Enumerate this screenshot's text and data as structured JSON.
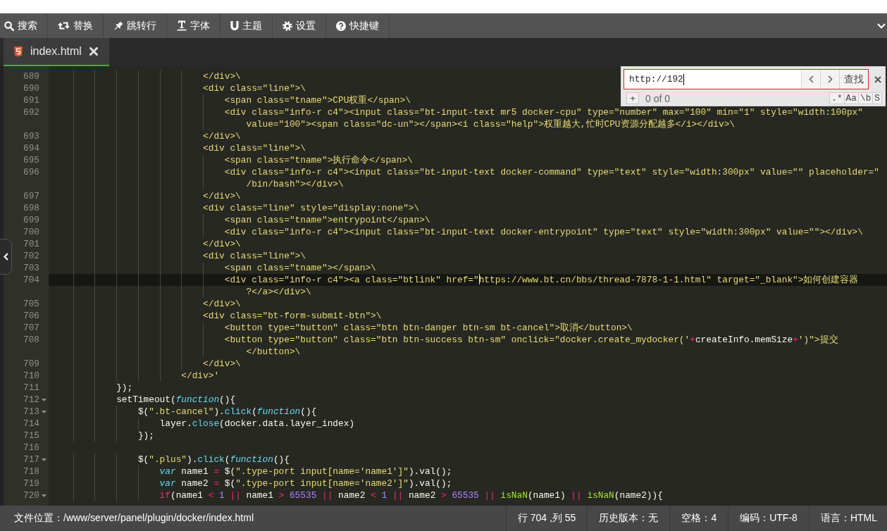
{
  "toolbar": {
    "items": [
      "搜索",
      "替换",
      "跳转行",
      "字体",
      "主题",
      "设置",
      "快捷键"
    ]
  },
  "tabs": [
    {
      "label": "index.html",
      "selected": true
    }
  ],
  "editor": {
    "lines": [
      {
        "number": "689",
        "foldable": false,
        "current": false,
        "tokens": [
          {
            "kind": "string",
            "text": "                            </div>\\"
          }
        ]
      },
      {
        "number": "690",
        "foldable": false,
        "current": false,
        "tokens": [
          {
            "kind": "string",
            "text": "                            <div class=\"line\">\\"
          }
        ]
      },
      {
        "number": "691",
        "foldable": false,
        "current": false,
        "tokens": [
          {
            "kind": "string",
            "text": "                                <span class=\"tname\">CPU权重</span>\\"
          }
        ]
      },
      {
        "number": "692",
        "foldable": false,
        "current": false,
        "tokens": [
          {
            "kind": "string",
            "text": "                                <div class=\"info-r c4\"><input class=\"bt-input-text mr5 docker-cpu\" type=\"number\" max=\"100\" min=\"1\" style=\"width:100px\""
          }
        ],
        "wrap": [
          {
            "kind": "string",
            "text": "value=\"100\"><span class=\"dc-un\"></span><i class=\"help\">权重越大,忙时CPU资源分配越多</i></div>\\"
          }
        ]
      },
      {
        "number": "693",
        "foldable": false,
        "current": false,
        "tokens": [
          {
            "kind": "string",
            "text": "                            </div>\\"
          }
        ]
      },
      {
        "number": "694",
        "foldable": false,
        "current": false,
        "tokens": [
          {
            "kind": "string",
            "text": "                            <div class=\"line\">\\"
          }
        ]
      },
      {
        "number": "695",
        "foldable": false,
        "current": false,
        "tokens": [
          {
            "kind": "string",
            "text": "                                <span class=\"tname\">执行命令</span>\\"
          }
        ]
      },
      {
        "number": "696",
        "foldable": false,
        "current": false,
        "tokens": [
          {
            "kind": "string",
            "text": "                                <div class=\"info-r c4\"><input class=\"bt-input-text docker-command\" type=\"text\" style=\"width:300px\" value=\"\" placeholder=\""
          }
        ],
        "wrap": [
          {
            "kind": "string",
            "text": "/bin/bash\"></div>\\"
          }
        ]
      },
      {
        "number": "697",
        "foldable": false,
        "current": false,
        "tokens": [
          {
            "kind": "string",
            "text": "                            </div>\\"
          }
        ]
      },
      {
        "number": "698",
        "foldable": false,
        "current": false,
        "tokens": [
          {
            "kind": "string",
            "text": "                            <div class=\"line\" style=\"display:none\">\\"
          }
        ]
      },
      {
        "number": "699",
        "foldable": false,
        "current": false,
        "tokens": [
          {
            "kind": "string",
            "text": "                                <span class=\"tname\">entrypoint</span>\\"
          }
        ]
      },
      {
        "number": "700",
        "foldable": false,
        "current": false,
        "tokens": [
          {
            "kind": "string",
            "text": "                                <div class=\"info-r c4\"><input class=\"bt-input-text docker-entrypoint\" type=\"text\" style=\"width:300px\" value=\"\"></div>\\"
          }
        ]
      },
      {
        "number": "701",
        "foldable": false,
        "current": false,
        "tokens": [
          {
            "kind": "string",
            "text": "                            </div>\\"
          }
        ]
      },
      {
        "number": "702",
        "foldable": false,
        "current": false,
        "tokens": [
          {
            "kind": "string",
            "text": "                            <div class=\"line\">\\"
          }
        ]
      },
      {
        "number": "703",
        "foldable": false,
        "current": false,
        "tokens": [
          {
            "kind": "string",
            "text": "                                <span class=\"tname\"></span>\\"
          }
        ]
      },
      {
        "number": "704",
        "foldable": false,
        "current": true,
        "tokens": [
          {
            "kind": "string",
            "text": "                                <div class=\"info-r c4\"><a class=\"btlink\" href=\""
          },
          {
            "kind": "cursor"
          },
          {
            "kind": "string",
            "text": "https://www.bt.cn/bbs/thread-7878-1-1.html\" target=\"_blank\">如何创建容器"
          }
        ],
        "wrap": [
          {
            "kind": "string",
            "text": "?</a></div>\\"
          }
        ]
      },
      {
        "number": "705",
        "foldable": false,
        "current": false,
        "tokens": [
          {
            "kind": "string",
            "text": "                            </div>\\"
          }
        ]
      },
      {
        "number": "706",
        "foldable": false,
        "current": false,
        "tokens": [
          {
            "kind": "string",
            "text": "                            <div class=\"bt-form-submit-btn\">\\"
          }
        ]
      },
      {
        "number": "707",
        "foldable": false,
        "current": false,
        "tokens": [
          {
            "kind": "string",
            "text": "                                <button type=\"button\" class=\"btn btn-danger btn-sm bt-cancel\">取消</button>\\"
          }
        ]
      },
      {
        "number": "708",
        "foldable": false,
        "current": false,
        "tokens": [
          {
            "kind": "string",
            "text": "                                <button type=\"button\" class=\"btn btn-success btn-sm\" onclick=\"docker.create_mydocker('"
          },
          {
            "kind": "operator",
            "text": "+"
          },
          {
            "kind": "plain",
            "text": "createInfo.memSize"
          },
          {
            "kind": "operator",
            "text": "+"
          },
          {
            "kind": "string",
            "text": "')\">提交"
          }
        ],
        "wrap": [
          {
            "kind": "string",
            "text": "</button>\\"
          }
        ]
      },
      {
        "number": "709",
        "foldable": false,
        "current": false,
        "tokens": [
          {
            "kind": "string",
            "text": "                            </div>\\"
          }
        ]
      },
      {
        "number": "710",
        "foldable": false,
        "current": false,
        "tokens": [
          {
            "kind": "string",
            "text": "                        </div>'"
          }
        ]
      },
      {
        "number": "711",
        "foldable": false,
        "current": false,
        "tokens": [
          {
            "kind": "plain",
            "text": "            });"
          }
        ]
      },
      {
        "number": "712",
        "foldable": true,
        "current": false,
        "tokens": [
          {
            "kind": "plain",
            "text": "            setTimeout("
          },
          {
            "kind": "storage",
            "text": "function"
          },
          {
            "kind": "plain",
            "text": "(){"
          }
        ]
      },
      {
        "number": "713",
        "foldable": true,
        "current": false,
        "tokens": [
          {
            "kind": "plain",
            "text": "                $("
          },
          {
            "kind": "string",
            "text": "\".bt-cancel\""
          },
          {
            "kind": "plain",
            "text": ")."
          },
          {
            "kind": "support",
            "text": "click"
          },
          {
            "kind": "plain",
            "text": "("
          },
          {
            "kind": "storage",
            "text": "function"
          },
          {
            "kind": "plain",
            "text": "(){"
          }
        ]
      },
      {
        "number": "714",
        "foldable": false,
        "current": false,
        "tokens": [
          {
            "kind": "plain",
            "text": "                    layer."
          },
          {
            "kind": "support",
            "text": "close"
          },
          {
            "kind": "plain",
            "text": "(docker.data.layer_index)"
          }
        ]
      },
      {
        "number": "715",
        "foldable": false,
        "current": false,
        "tokens": [
          {
            "kind": "plain",
            "text": "                });"
          }
        ]
      },
      {
        "number": "716",
        "foldable": false,
        "current": false
      },
      {
        "number": "717",
        "foldable": true,
        "current": false,
        "tokens": [
          {
            "kind": "plain",
            "text": "                $("
          },
          {
            "kind": "string",
            "text": "\".plus\""
          },
          {
            "kind": "plain",
            "text": ")."
          },
          {
            "kind": "support",
            "text": "click"
          },
          {
            "kind": "plain",
            "text": "("
          },
          {
            "kind": "storage",
            "text": "function"
          },
          {
            "kind": "plain",
            "text": "(){"
          }
        ]
      },
      {
        "number": "718",
        "foldable": false,
        "current": false,
        "tokens": [
          {
            "kind": "storage",
            "text": "                    var"
          },
          {
            "kind": "plain",
            "text": " name1 "
          },
          {
            "kind": "operator",
            "text": "="
          },
          {
            "kind": "plain",
            "text": " $("
          },
          {
            "kind": "string",
            "text": "\".type-port input[name='name1']\""
          },
          {
            "kind": "plain",
            "text": ").val();"
          }
        ]
      },
      {
        "number": "719",
        "foldable": false,
        "current": false,
        "tokens": [
          {
            "kind": "storage",
            "text": "                    var"
          },
          {
            "kind": "plain",
            "text": " name2 "
          },
          {
            "kind": "operator",
            "text": "="
          },
          {
            "kind": "plain",
            "text": " $("
          },
          {
            "kind": "string",
            "text": "\".type-port input[name='name2']\""
          },
          {
            "kind": "plain",
            "text": ").val();"
          }
        ]
      },
      {
        "number": "720",
        "foldable": true,
        "current": false,
        "tokens": [
          {
            "kind": "keyword",
            "text": "                    if"
          },
          {
            "kind": "plain",
            "text": "(name1 "
          },
          {
            "kind": "operator",
            "text": "<"
          },
          {
            "kind": "number",
            "text": " 1 "
          },
          {
            "kind": "operator",
            "text": "||"
          },
          {
            "kind": "plain",
            "text": " name1 "
          },
          {
            "kind": "operator",
            "text": ">"
          },
          {
            "kind": "number",
            "text": " 65535 "
          },
          {
            "kind": "operator",
            "text": "||"
          },
          {
            "kind": "plain",
            "text": " name2 "
          },
          {
            "kind": "operator",
            "text": "<"
          },
          {
            "kind": "number",
            "text": " 1 "
          },
          {
            "kind": "operator",
            "text": "||"
          },
          {
            "kind": "plain",
            "text": " name2 "
          },
          {
            "kind": "operator",
            "text": ">"
          },
          {
            "kind": "number",
            "text": " 65535 "
          },
          {
            "kind": "operator",
            "text": "||"
          },
          {
            "kind": "builtin",
            "text": " isNaN"
          },
          {
            "kind": "plain",
            "text": "(name1) "
          },
          {
            "kind": "operator",
            "text": "||"
          },
          {
            "kind": "builtin",
            "text": " isNaN"
          },
          {
            "kind": "plain",
            "text": "(name2)){"
          }
        ]
      }
    ]
  },
  "search": {
    "value": "http://192",
    "find_button": "查找",
    "add_button": "+",
    "match_count": "0 of 0",
    "options": [
      {
        "label": ".*",
        "selected": false
      },
      {
        "label": "Aa",
        "selected": false
      },
      {
        "label": "\\b",
        "selected": false
      },
      {
        "label": "S",
        "selected": false
      }
    ]
  },
  "status_bar": {
    "file_path": "文件位置：/www/server/panel/plugin/docker/index.html",
    "items": [
      "行 704 ,列 55",
      "历史版本：无",
      "空格：4",
      "编码：UTF-8",
      "语言：HTML"
    ]
  }
}
